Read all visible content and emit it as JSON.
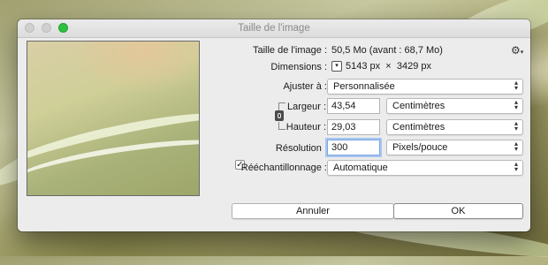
{
  "window": {
    "title": "Taille de l'image"
  },
  "image_size": {
    "label": "Taille de l'image :",
    "value": "50,5 Mo (avant : 68,7 Mo)"
  },
  "dimensions": {
    "label": "Dimensions :",
    "width": "5143 px",
    "times": "×",
    "height": "3429 px"
  },
  "fit": {
    "label": "Ajuster à :",
    "value": "Personnalisée"
  },
  "width": {
    "label": "Largeur :",
    "value": "43,54",
    "unit": "Centimètres"
  },
  "height": {
    "label": "Hauteur :",
    "value": "29,03",
    "unit": "Centimètres"
  },
  "resolution": {
    "label": "Résolution :",
    "value": "300",
    "unit": "Pixels/pouce"
  },
  "resample": {
    "label": "Rééchantillonnage :",
    "checked": true,
    "value": "Automatique"
  },
  "buttons": {
    "cancel": "Annuler",
    "ok": "OK"
  },
  "icons": {
    "gear": "gear-icon",
    "link": "chain-link-icon",
    "dim": "chevron-down-icon"
  }
}
